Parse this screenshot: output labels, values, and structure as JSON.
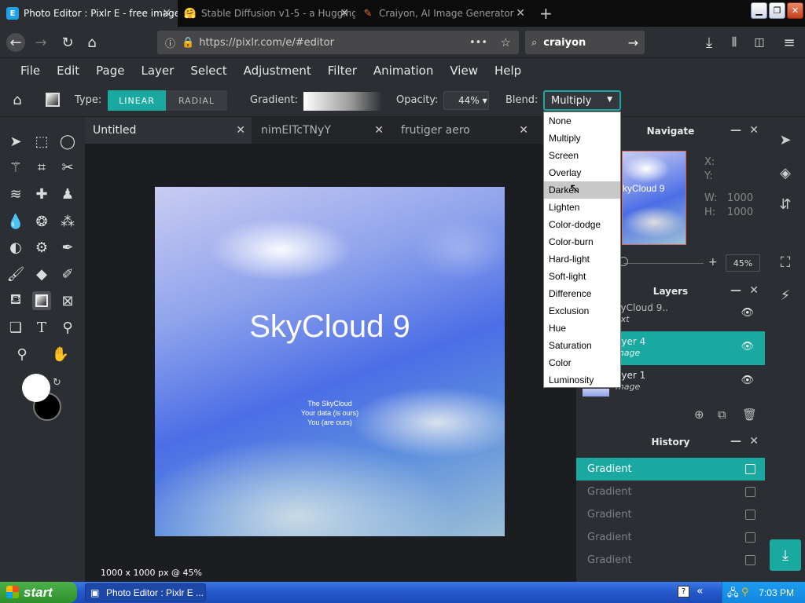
{
  "browser": {
    "tabs": [
      {
        "title": "Photo Editor : Pixlr E - free image",
        "active": true
      },
      {
        "title": "Stable Diffusion v1-5 - a Hugging",
        "active": false
      },
      {
        "title": "Craiyon, AI Image Generator",
        "active": false
      }
    ],
    "new_tab": "+",
    "url": "https://pixlr.com/e/#editor",
    "url_more": "•••",
    "search_value": "craiyon"
  },
  "menu": {
    "items": [
      "File",
      "Edit",
      "Page",
      "Layer",
      "Select",
      "Adjustment",
      "Filter",
      "Animation",
      "View",
      "Help"
    ]
  },
  "toolbar": {
    "type_label": "Type:",
    "linear_label": "LINEAR",
    "radial_label": "RADIAL",
    "gradient_label": "Gradient:",
    "opacity_label": "Opacity:",
    "opacity_value": "44%",
    "blend_label": "Blend:",
    "blend_value": "Multiply"
  },
  "blend_options": [
    "None",
    "Multiply",
    "Screen",
    "Overlay",
    "Darken",
    "Lighten",
    "Color-dodge",
    "Color-burn",
    "Hard-light",
    "Soft-light",
    "Difference",
    "Exclusion",
    "Hue",
    "Saturation",
    "Color",
    "Luminosity"
  ],
  "doc_tabs": [
    {
      "title": "Untitled",
      "active": true
    },
    {
      "title": "nimElTcTNyY",
      "active": false
    },
    {
      "title": "frutiger aero",
      "active": false
    }
  ],
  "artwork": {
    "title": "SkyCloud 9",
    "line1": "The SkyCloud",
    "line2": "Your data (is ours)",
    "line3": "You (are ours)"
  },
  "status": {
    "size": "1000 x 1000 px @ 45%"
  },
  "navigate": {
    "title": "Navigate",
    "thumb_text": "kyCloud 9",
    "x_label": "X:",
    "y_label": "Y:",
    "w_label": "W:",
    "w_value": "1000",
    "h_label": "H:",
    "h_value": "1000",
    "zoom": "45%"
  },
  "layers": {
    "title": "Layers",
    "items": [
      {
        "name": "kyCloud 9..",
        "type": "ext",
        "selected": false
      },
      {
        "name": "ayer 4",
        "type": "mage",
        "selected": true
      },
      {
        "name": "ayer 1",
        "type": "mage",
        "selected": false
      }
    ]
  },
  "history": {
    "title": "History",
    "items": [
      "Gradient",
      "Gradient",
      "Gradient",
      "Gradient",
      "Gradient"
    ]
  },
  "taskbar": {
    "start": "start",
    "task": "Photo Editor : Pixlr E ...",
    "clock": "7:03 PM"
  },
  "colors": {
    "accent": "#19a9a0",
    "panel": "#2b2e33",
    "canvas_bg": "#1c1d20"
  }
}
